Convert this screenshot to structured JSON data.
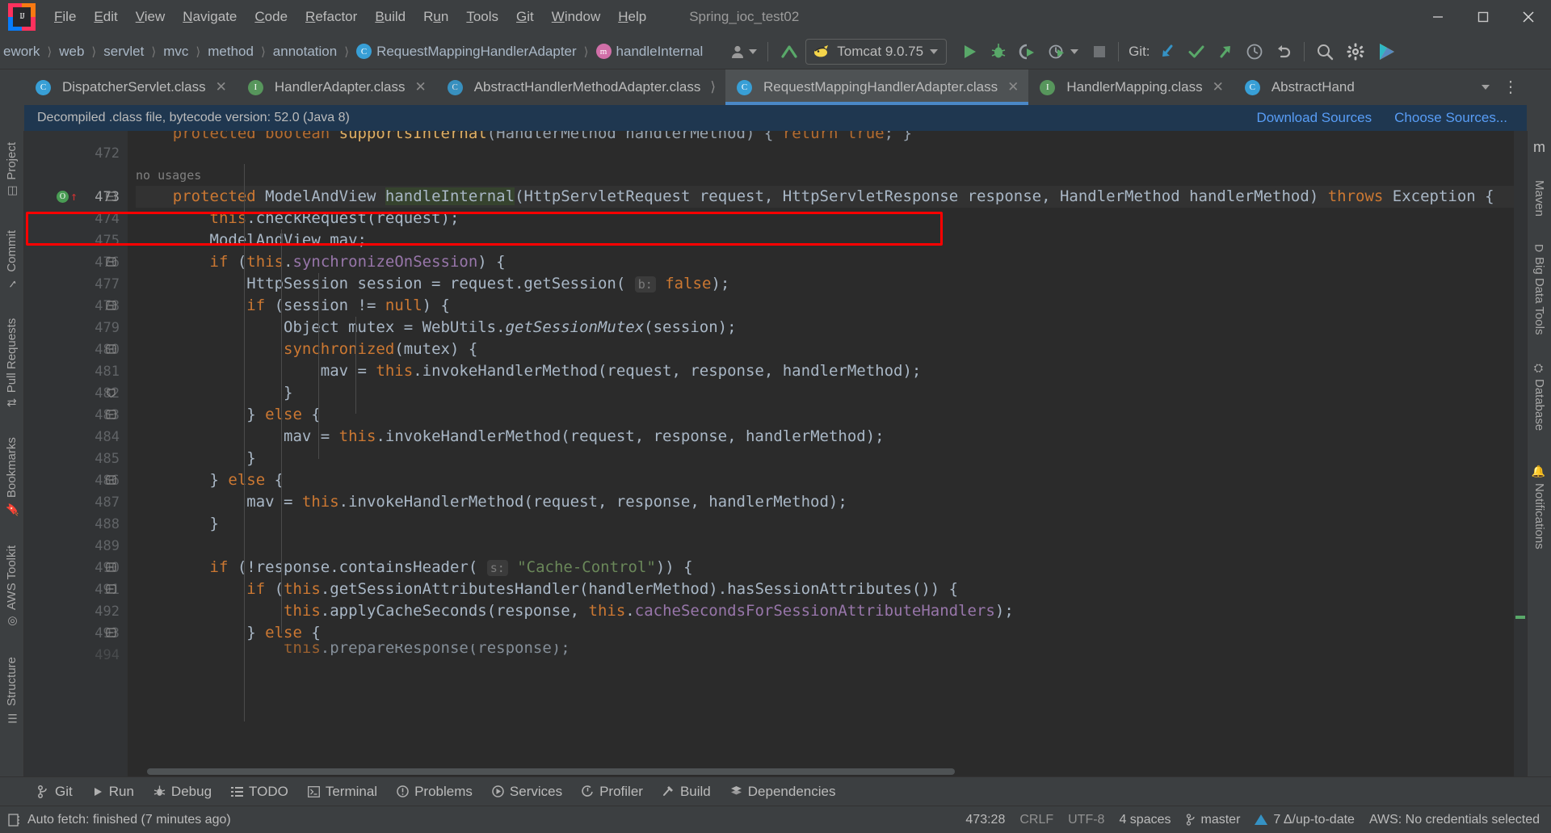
{
  "window": {
    "project_title": "Spring_ioc_test02",
    "logo_text": "IJ",
    "controls": {
      "minimize": "minimize-icon",
      "maximize": "maximize-icon",
      "close": "close-icon"
    }
  },
  "menubar": {
    "items": [
      {
        "label": "File",
        "mnemonic": "F"
      },
      {
        "label": "Edit",
        "mnemonic": "E"
      },
      {
        "label": "View",
        "mnemonic": "V"
      },
      {
        "label": "Navigate",
        "mnemonic": "N"
      },
      {
        "label": "Code",
        "mnemonic": "C"
      },
      {
        "label": "Refactor",
        "mnemonic": "R"
      },
      {
        "label": "Build",
        "mnemonic": "B"
      },
      {
        "label": "Run",
        "mnemonic": "u"
      },
      {
        "label": "Tools",
        "mnemonic": "T"
      },
      {
        "label": "Git",
        "mnemonic": "G"
      },
      {
        "label": "Window",
        "mnemonic": "W"
      },
      {
        "label": "Help",
        "mnemonic": "H"
      }
    ]
  },
  "navbar": {
    "breadcrumbs": [
      {
        "label": "ework",
        "icon": ""
      },
      {
        "label": "web",
        "icon": ""
      },
      {
        "label": "servlet",
        "icon": ""
      },
      {
        "label": "mvc",
        "icon": ""
      },
      {
        "label": "method",
        "icon": ""
      },
      {
        "label": "annotation",
        "icon": ""
      },
      {
        "label": "RequestMappingHandlerAdapter",
        "icon": "class-icon",
        "icon_letter": "C"
      },
      {
        "label": "handleInternal",
        "icon": "method-icon",
        "icon_letter": "m"
      }
    ],
    "run_config": {
      "name": "Tomcat 9.0.75",
      "icon": "tomcat-icon"
    },
    "buttons": {
      "user_icon": "user-avatar-icon",
      "update_icon": "update-project-icon",
      "run": "run-icon",
      "debug": "debug-icon",
      "run_coverage": "run-with-coverage-icon",
      "profiler": "profiler-icon",
      "stop": "stop-icon",
      "search": "search-everywhere-icon",
      "settings": "settings-gear-icon",
      "plugin": "idea-services-icon"
    },
    "git": {
      "label": "Git:",
      "update": "git-update-icon",
      "commit": "git-commit-icon",
      "push": "git-push-icon",
      "history": "git-history-icon",
      "rollback": "git-rollback-icon"
    }
  },
  "editor_tabs": {
    "tabs": [
      {
        "label": "DispatcherServlet.class",
        "icon_letter": "C",
        "icon_kind": "class",
        "active": false,
        "closable": true
      },
      {
        "label": "HandlerAdapter.class",
        "icon_letter": "I",
        "icon_kind": "interface",
        "active": false,
        "closable": true
      },
      {
        "label": "AbstractHandlerMethodAdapter.class",
        "icon_letter": "C",
        "icon_kind": "abstract-class",
        "active": false,
        "closable": false
      },
      {
        "label": "RequestMappingHandlerAdapter.class",
        "icon_letter": "C",
        "icon_kind": "class",
        "active": true,
        "closable": true
      },
      {
        "label": "HandlerMapping.class",
        "icon_letter": "I",
        "icon_kind": "interface",
        "active": false,
        "closable": true
      },
      {
        "label": "AbstractHand",
        "icon_letter": "C",
        "icon_kind": "class",
        "active": false,
        "closable": false
      }
    ],
    "overflow_icon": "chevron-down-icon",
    "more_icon": "more-options-icon"
  },
  "notification": {
    "text": "Decompiled .class file, bytecode version: 52.0 (Java 8)",
    "links": [
      "Download Sources",
      "Choose Sources..."
    ]
  },
  "sidebar_left": [
    {
      "label": "Project",
      "icon": "project-icon"
    },
    {
      "label": "Commit",
      "icon": "commit-icon"
    },
    {
      "label": "Pull Requests",
      "icon": "pull-requests-icon"
    },
    {
      "label": "Bookmarks",
      "icon": "bookmarks-icon"
    },
    {
      "label": "AWS Toolkit",
      "icon": "aws-icon"
    },
    {
      "label": "Structure",
      "icon": "structure-icon"
    }
  ],
  "sidebar_right": [
    {
      "label": "m",
      "icon": "maven-logo-icon"
    },
    {
      "label": "Maven",
      "icon": "maven-icon"
    },
    {
      "label": "Big Data Tools",
      "icon": "big-data-tools-icon"
    },
    {
      "label": "Database",
      "icon": "database-icon"
    },
    {
      "label": "Notifications",
      "icon": "notifications-icon"
    }
  ],
  "editor": {
    "current_line": 473,
    "gutter_icons": {
      "override": "override-method-icon",
      "arrow": "implementing-arrow-icon"
    },
    "annotation": "no usages",
    "lines": [
      {
        "n": 472,
        "text": "",
        "fold": false
      },
      {
        "n": 473,
        "text": "    protected ModelAndView handleInternal(HttpServletRequest request, HttpServletResponse response, HandlerMethod handlerMethod) throws Exception {",
        "fold": true,
        "current": true
      },
      {
        "n": 474,
        "text": "        this.checkRequest(request);",
        "fold": false
      },
      {
        "n": 475,
        "text": "        ModelAndView mav;",
        "fold": false
      },
      {
        "n": 476,
        "text": "        if (this.synchronizeOnSession) {",
        "fold": true
      },
      {
        "n": 477,
        "text": "            HttpSession session = request.getSession( b: false);",
        "fold": false
      },
      {
        "n": 478,
        "text": "            if (session != null) {",
        "fold": true
      },
      {
        "n": 479,
        "text": "                Object mutex = WebUtils.getSessionMutex(session);",
        "fold": false
      },
      {
        "n": 480,
        "text": "                synchronized(mutex) {",
        "fold": true
      },
      {
        "n": 481,
        "text": "                    mav = this.invokeHandlerMethod(request, response, handlerMethod);",
        "fold": false
      },
      {
        "n": 482,
        "text": "                }",
        "fold": true
      },
      {
        "n": 483,
        "text": "            } else {",
        "fold": true
      },
      {
        "n": 484,
        "text": "                mav = this.invokeHandlerMethod(request, response, handlerMethod);",
        "fold": false
      },
      {
        "n": 485,
        "text": "            }",
        "fold": false
      },
      {
        "n": 486,
        "text": "        } else {",
        "fold": true
      },
      {
        "n": 487,
        "text": "            mav = this.invokeHandlerMethod(request, response, handlerMethod);",
        "fold": false
      },
      {
        "n": 488,
        "text": "        }",
        "fold": false
      },
      {
        "n": 489,
        "text": "",
        "fold": false
      },
      {
        "n": 490,
        "text": "        if (!response.containsHeader( s: \"Cache-Control\")) {",
        "fold": true
      },
      {
        "n": 491,
        "text": "            if (this.getSessionAttributesHandler(handlerMethod).hasSessionAttributes()) {",
        "fold": true
      },
      {
        "n": 492,
        "text": "                this.applyCacheSeconds(response, this.cacheSecondsForSessionAttributeHandlers);",
        "fold": false
      },
      {
        "n": 493,
        "text": "            } else {",
        "fold": true
      },
      {
        "n": 494,
        "text": "                this.prepareResponse(response);",
        "fold": false
      }
    ]
  },
  "bottom_toolwindows": [
    {
      "label": "Git",
      "icon": "git-branch-icon"
    },
    {
      "label": "Run",
      "icon": "run-triangle-icon"
    },
    {
      "label": "Debug",
      "icon": "debug-bug-icon"
    },
    {
      "label": "TODO",
      "icon": "todo-list-icon"
    },
    {
      "label": "Terminal",
      "icon": "terminal-icon"
    },
    {
      "label": "Problems",
      "icon": "problems-icon"
    },
    {
      "label": "Services",
      "icon": "services-icon"
    },
    {
      "label": "Profiler",
      "icon": "profiler-icon"
    },
    {
      "label": "Build",
      "icon": "build-hammer-icon"
    },
    {
      "label": "Dependencies",
      "icon": "dependencies-icon"
    }
  ],
  "statusbar": {
    "left_icon": "status-log-icon",
    "message": "Auto fetch: finished (7 minutes ago)",
    "caret_position": "473:28",
    "line_separator": "CRLF",
    "encoding": "UTF-8",
    "indent": "4 spaces",
    "branch": "master",
    "branch_icon": "git-branch-icon",
    "updates": "7 Δ/up-to-date",
    "updates_icon": "update-triangle-icon",
    "aws": "AWS: No credentials selected"
  },
  "colors": {
    "accent_blue": "#4a88c7",
    "link_blue": "#589df6",
    "notif_bg": "#1f3750",
    "editor_bg": "#2b2b2b",
    "gutter_bg": "#313335",
    "chrome_bg": "#3c3f41",
    "highlight_red": "#ff0000",
    "keyword": "#cc7832",
    "field": "#9876aa",
    "string": "#6a8759",
    "text": "#a9b7c6"
  }
}
